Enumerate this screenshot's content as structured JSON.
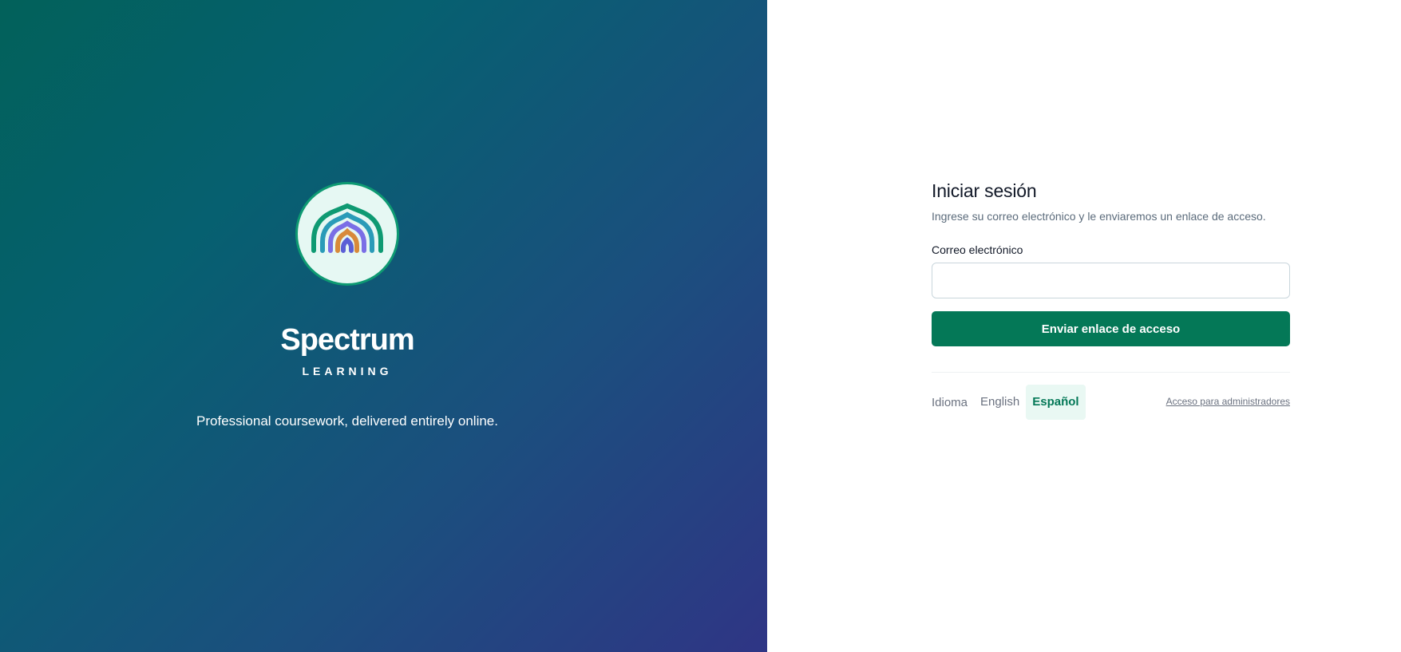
{
  "brand": {
    "name": "Spectrum",
    "subtitle": "LEARNING",
    "tagline": "Professional coursework, delivered entirely online.",
    "logo_icon": "rainbow-arch-logo",
    "colors": {
      "gradient_start": "#02615a",
      "gradient_end": "#2f3585",
      "logo_ring": "#0e9a72",
      "logo_arcs": [
        "#0e9a72",
        "#2a9bb8",
        "#7a6ee6",
        "#d88a3a",
        "#5b5fd6"
      ]
    }
  },
  "login": {
    "title": "Iniciar sesión",
    "subtitle": "Ingrese su correo electrónico y le enviaremos un enlace de acceso.",
    "email_label": "Correo electrónico",
    "email_value": "",
    "email_placeholder": "",
    "submit_label": "Enviar enlace de acceso",
    "accent_color": "#047857"
  },
  "language": {
    "label": "Idioma",
    "options": [
      {
        "label": "English",
        "active": false
      },
      {
        "label": "Español",
        "active": true
      }
    ]
  },
  "admin_link": "Acceso para administradores"
}
